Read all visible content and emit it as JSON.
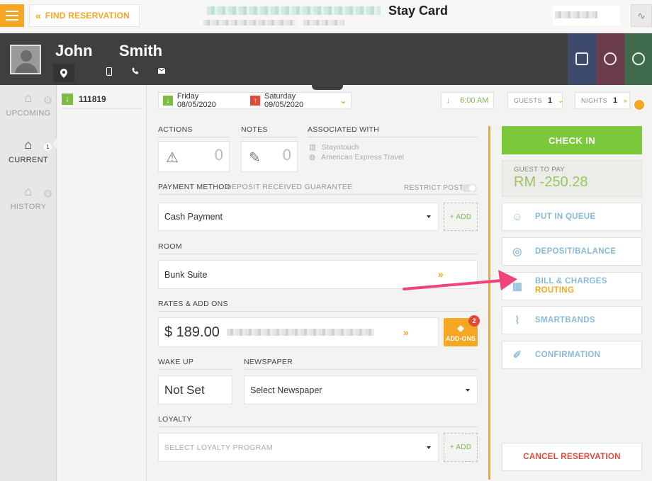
{
  "topbar": {
    "find_reservation": "FIND RESERVATION",
    "title": "Stay Card"
  },
  "guest": {
    "first_name": "John",
    "last_name": "Smith"
  },
  "rail": {
    "items": [
      {
        "label": "UPCOMING",
        "count": "0"
      },
      {
        "label": "CURRENT",
        "count": "1"
      },
      {
        "label": "HISTORY",
        "count": "0"
      }
    ]
  },
  "reservation": {
    "number": "111819"
  },
  "dates": {
    "arrival": "Friday 08/05/2020",
    "departure": "Saturday 09/05/2020",
    "time": "6:00 AM",
    "guests_label": "GUESTS",
    "guests_count": "1",
    "nights_label": "NIGHTS",
    "nights_count": "1"
  },
  "sections": {
    "actions_label": "ACTIONS",
    "actions_count": "0",
    "notes_label": "NOTES",
    "notes_count": "0",
    "associated_label": "ASSOCIATED WITH",
    "associated": [
      "Stayntouch",
      "American Express Travel"
    ],
    "payment_label": "PAYMENT METHOD",
    "payment_sub": "DEPOSIT RECEIVED GUARANTEE",
    "restrict_post": "RESTRICT POST",
    "payment_value": "Cash Payment",
    "add": "+ ADD",
    "room_label": "ROOM",
    "room_value": "Bunk Suite",
    "rates_label": "RATES & ADD ONS",
    "rate_value": "$ 189.00",
    "addons_label": "ADD-ONS",
    "addons_count": "2",
    "wakeup_label": "WAKE UP",
    "wakeup_value": "Not Set",
    "newspaper_label": "NEWSPAPER",
    "newspaper_value": "Select Newspaper",
    "loyalty_label": "LOYALTY",
    "loyalty_value": "SELECT LOYALTY PROGRAM"
  },
  "actions_panel": {
    "check_in": "CHECK IN",
    "guest_to_pay_label": "GUEST TO PAY",
    "guest_to_pay_amount": "RM -250.28",
    "put_in_queue": "PUT IN QUEUE",
    "deposit_balance": "DEPOSIT/BALANCE",
    "bill_charges": "BILL & CHARGES",
    "routing": "ROUTING",
    "smartbands": "SMARTBANDS",
    "confirmation": "CONFIRMATION",
    "cancel_reservation": "CANCEL RESERVATION"
  },
  "colors": {
    "accent_orange": "#f5a623",
    "check_in_green": "#7cc83b",
    "cancel_red": "#e04b3a",
    "annotation_arrow": "#f0457a"
  }
}
